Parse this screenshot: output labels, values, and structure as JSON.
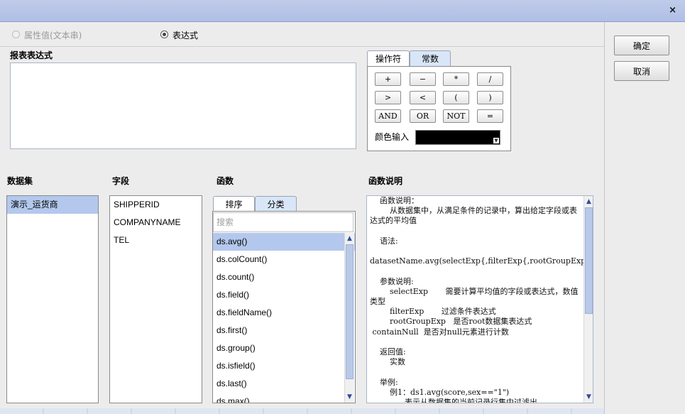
{
  "window": {
    "close_glyph": "×"
  },
  "mode": {
    "option_property": "属性值(文本串)",
    "option_expression": "表达式",
    "selected": "expression"
  },
  "expression": {
    "label": "报表表达式",
    "value": ""
  },
  "operator_panel": {
    "tabs": [
      "操作符",
      "常数"
    ],
    "active_tab": "操作符",
    "buttons": [
      "+",
      "−",
      "*",
      "/",
      ">",
      "<",
      "(",
      ")",
      "AND",
      "OR",
      "NOT",
      "="
    ],
    "color_label": "颜色输入",
    "color_value": "#000000"
  },
  "actions": {
    "ok": "确定",
    "cancel": "取消"
  },
  "dataset": {
    "label": "数据集",
    "items": [
      "演示_运货商"
    ],
    "selected_index": 0
  },
  "fields": {
    "label": "字段",
    "items": [
      "SHIPPERID",
      "COMPANYNAME",
      "TEL"
    ]
  },
  "functions": {
    "label": "函数",
    "tabs": [
      "排序",
      "分类"
    ],
    "active_tab": "排序",
    "search_placeholder": "搜索",
    "items": [
      "ds.avg()",
      "ds.colCount()",
      "ds.count()",
      "ds.field()",
      "ds.fieldName()",
      "ds.first()",
      "ds.group()",
      "ds.isfield()",
      "ds.last()",
      "ds.max()"
    ],
    "selected_index": 0
  },
  "description": {
    "label": "函数说明",
    "text": "    函数说明：\n        从数据集中，从满足条件的记录中，算出给定字段或表达式的平均值\n\n    语法:\n        datasetName.avg(selectExp{,filterExp{,rootGroupExp{,containNull}}})\n\n    参数说明:\n        selectExp       需要计算平均值的字段或表达式，数值类型\n        filterExp       过滤条件表达式\n        rootGroupExp   是否root数据集表达式\n containNull  是否对null元素进行计数\n\n    返回值:\n        实数\n\n    举例:\n        例1：ds1.avg(score,sex==\"1\")\n              表示从数据集的当前记录行集中过滤出"
  },
  "colors": {
    "titlebar": "#b3c1e7",
    "selection": "#b3c8ec",
    "tab_inactive": "#d9e6f7",
    "scroll_arrow": "#2d4f9c"
  }
}
